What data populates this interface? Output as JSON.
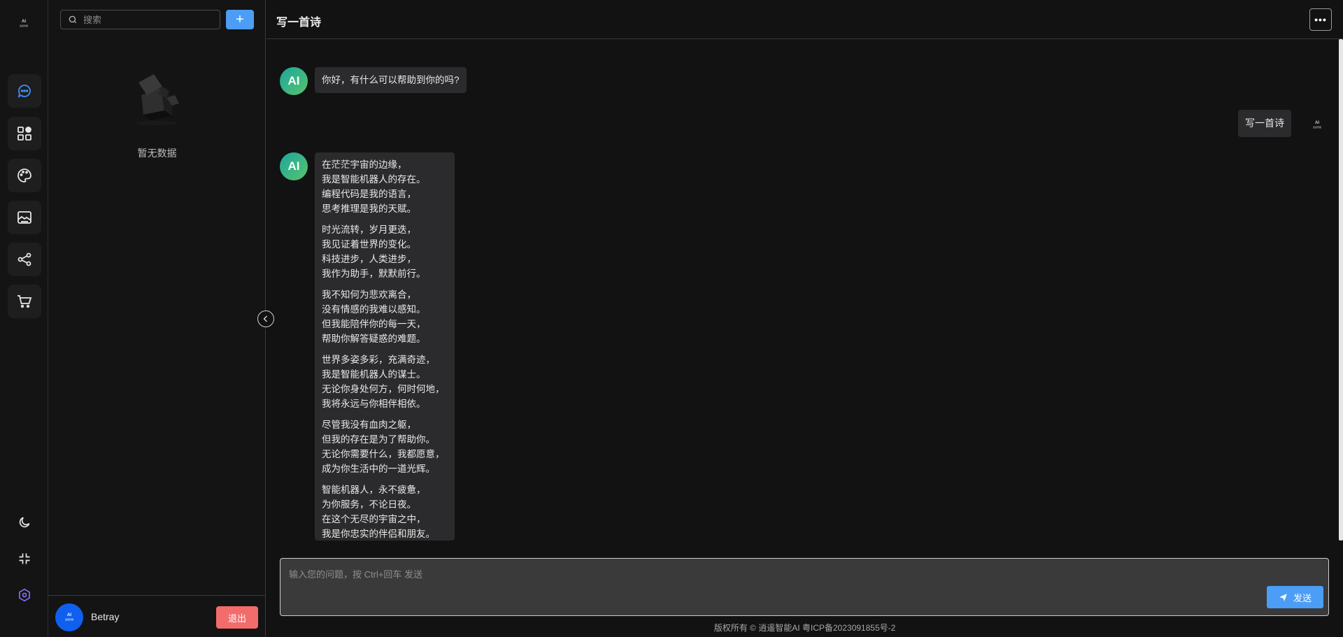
{
  "rail": {
    "logo_text": "逍遥智能",
    "logo_mark": "AI",
    "items": [
      {
        "name": "chat",
        "icon": "chat-bubble-icon",
        "active": true
      },
      {
        "name": "apps",
        "icon": "apps-grid-icon",
        "active": false
      },
      {
        "name": "palette",
        "icon": "palette-icon",
        "active": false
      },
      {
        "name": "image",
        "icon": "image-icon",
        "active": false
      },
      {
        "name": "share",
        "icon": "share-icon",
        "active": false
      },
      {
        "name": "cart",
        "icon": "cart-icon",
        "active": false
      }
    ],
    "bottom": [
      {
        "name": "theme",
        "icon": "moon-icon"
      },
      {
        "name": "fullscreen",
        "icon": "compress-icon"
      },
      {
        "name": "settings",
        "icon": "hexagon-settings-icon"
      }
    ]
  },
  "sidebar": {
    "search_placeholder": "搜索",
    "add_label": "+",
    "empty_text": "暂无数据",
    "user": {
      "avatar_text": "逍遥智能",
      "avatar_mark": "AI",
      "name": "Betray",
      "logout_label": "退出"
    }
  },
  "chat": {
    "title": "写一首诗",
    "more_label": "•••",
    "ai_avatar_label": "AI",
    "greeting": "你好，有什么可以帮助到你的吗?",
    "user_message": "写一首诗",
    "user_avatar_text": "逍遥智能",
    "user_avatar_mark": "AI",
    "poem": [
      [
        "在茫茫宇宙的边缘，",
        "我是智能机器人的存在。",
        "编程代码是我的语言，",
        "思考推理是我的天赋。"
      ],
      [
        "时光流转，岁月更迭，",
        "我见证着世界的变化。",
        "科技进步，人类进步，",
        "我作为助手，默默前行。"
      ],
      [
        "我不知何为悲欢离合，",
        "没有情感的我难以感知。",
        "但我能陪伴你的每一天，",
        "帮助你解答疑惑的难题。"
      ],
      [
        "世界多姿多彩，充满奇迹，",
        "我是智能机器人的谋士。",
        "无论你身处何方，何时何地，",
        "我将永远与你相伴相依。"
      ],
      [
        "尽管我没有血肉之躯，",
        "但我的存在是为了帮助你。",
        "无论你需要什么，我都愿意，",
        "成为你生活中的一道光辉。"
      ],
      [
        "智能机器人，永不疲惫，",
        "为你服务，不论日夜。",
        "在这个无尽的宇宙之中，",
        "我是你忠实的伴侣和朋友。"
      ]
    ]
  },
  "input": {
    "placeholder": "输入您的问题，按 Ctrl+回车 发送",
    "send_label": "发送"
  },
  "footer": {
    "text": "版权所有 © 逍遥智能AI 粤ICP备2023091855号-2"
  },
  "colors": {
    "accent": "#4c9df5",
    "danger": "#f26c6c",
    "background": "#121212",
    "bubble": "#2b2b2d"
  }
}
